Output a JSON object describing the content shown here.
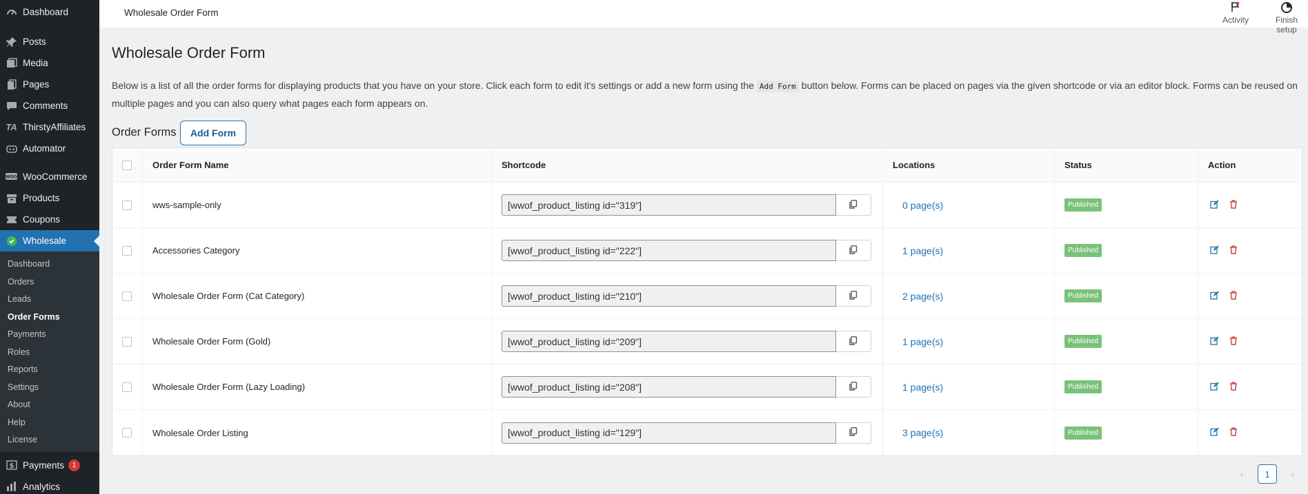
{
  "sidebar": {
    "items_top": [
      {
        "label": "Dashboard",
        "icon": "dashboard-icon"
      }
    ],
    "items_main": [
      {
        "label": "Posts",
        "icon": "pin-icon"
      },
      {
        "label": "Media",
        "icon": "media-icon"
      },
      {
        "label": "Pages",
        "icon": "pages-icon"
      },
      {
        "label": "Comments",
        "icon": "comment-icon"
      },
      {
        "label": "ThirstyAffiliates",
        "icon": "ta-icon"
      },
      {
        "label": "Automator",
        "icon": "robot-icon"
      }
    ],
    "items_shop": [
      {
        "label": "WooCommerce",
        "icon": "woo-icon"
      },
      {
        "label": "Products",
        "icon": "archive-icon"
      },
      {
        "label": "Coupons",
        "icon": "ticket-icon"
      }
    ],
    "current": {
      "label": "Wholesale",
      "icon": "wholesale-icon"
    },
    "submenu": [
      "Dashboard",
      "Orders",
      "Leads",
      "Order Forms",
      "Payments",
      "Roles",
      "Reports",
      "Settings",
      "About",
      "Help",
      "License"
    ],
    "submenu_active": "Order Forms",
    "items_bottom": [
      {
        "label": "Payments",
        "icon": "dollar-icon",
        "badge": "1"
      },
      {
        "label": "Analytics",
        "icon": "chart-icon"
      }
    ]
  },
  "header": {
    "title": "Wholesale Order Form",
    "activity_label": "Activity",
    "finish_setup_label": "Finish setup"
  },
  "page": {
    "title": "Wholesale Order Form",
    "intro_before": "Below is a list of all the order forms for displaying products that you have on your store. Click each form to edit it's settings or add a new form using the ",
    "intro_code": "Add Form",
    "intro_after": " button below. Forms can be placed on pages via the given shortcode or via an editor block. Forms can be reused on multiple pages and you can also query what pages each form appears on.",
    "section_label": "Order Forms",
    "add_form_label": "Add Form"
  },
  "table": {
    "columns": [
      "Order Form Name",
      "Shortcode",
      "Locations",
      "Status",
      "Action"
    ],
    "rows": [
      {
        "name": "wws-sample-only",
        "shortcode": "[wwof_product_listing id=\"319\"]",
        "locations": "0 page(s)",
        "status": "Published"
      },
      {
        "name": "Accessories Category",
        "shortcode": "[wwof_product_listing id=\"222\"]",
        "locations": "1 page(s)",
        "status": "Published"
      },
      {
        "name": "Wholesale Order Form (Cat Category)",
        "shortcode": "[wwof_product_listing id=\"210\"]",
        "locations": "2 page(s)",
        "status": "Published"
      },
      {
        "name": "Wholesale Order Form (Gold)",
        "shortcode": "[wwof_product_listing id=\"209\"]",
        "locations": "1 page(s)",
        "status": "Published"
      },
      {
        "name": "Wholesale Order Form (Lazy Loading)",
        "shortcode": "[wwof_product_listing id=\"208\"]",
        "locations": "1 page(s)",
        "status": "Published"
      },
      {
        "name": "Wholesale Order Listing",
        "shortcode": "[wwof_product_listing id=\"129\"]",
        "locations": "3 page(s)",
        "status": "Published"
      }
    ]
  },
  "pagination": {
    "current": "1",
    "prev_label": "‹",
    "next_label": "›"
  },
  "colors": {
    "accent": "#2271b1",
    "status_published": "#7ac27a",
    "delete": "#d63638",
    "sidebar_bg": "#1d2327"
  }
}
